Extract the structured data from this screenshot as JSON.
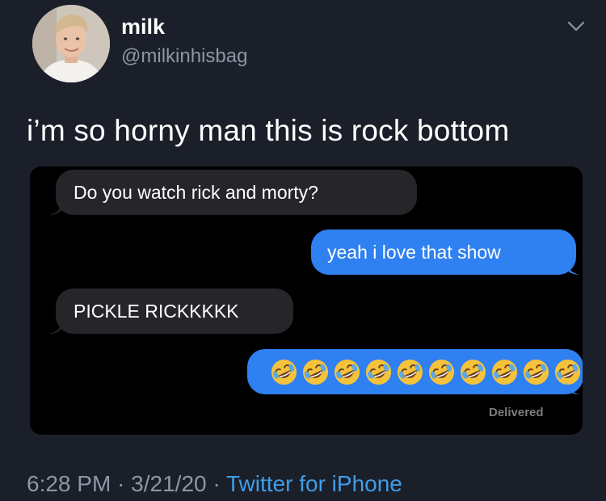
{
  "tweet": {
    "author_name": "milk",
    "author_handle": "@milkinhisbag",
    "text": "i’m so horny man this is rock bottom",
    "time": "6:28 PM",
    "separator": "·",
    "date": "3/21/20",
    "source": "Twitter for iPhone"
  },
  "screenshot": {
    "messages": [
      {
        "direction": "incoming",
        "text": "Do you watch rick and morty?"
      },
      {
        "direction": "outgoing",
        "text": "yeah i love that show"
      },
      {
        "direction": "incoming",
        "text": "PICKLE RICKKKKK"
      },
      {
        "direction": "outgoing",
        "emoji": "rolling-on-the-floor-laughing",
        "emoji_count": 10
      }
    ],
    "status": "Delivered"
  },
  "colors": {
    "background": "#1b1f29",
    "incoming_bubble": "#26262a",
    "outgoing_bubble": "#2f80f0",
    "link": "#3f9de8",
    "muted": "#8b98a5"
  }
}
